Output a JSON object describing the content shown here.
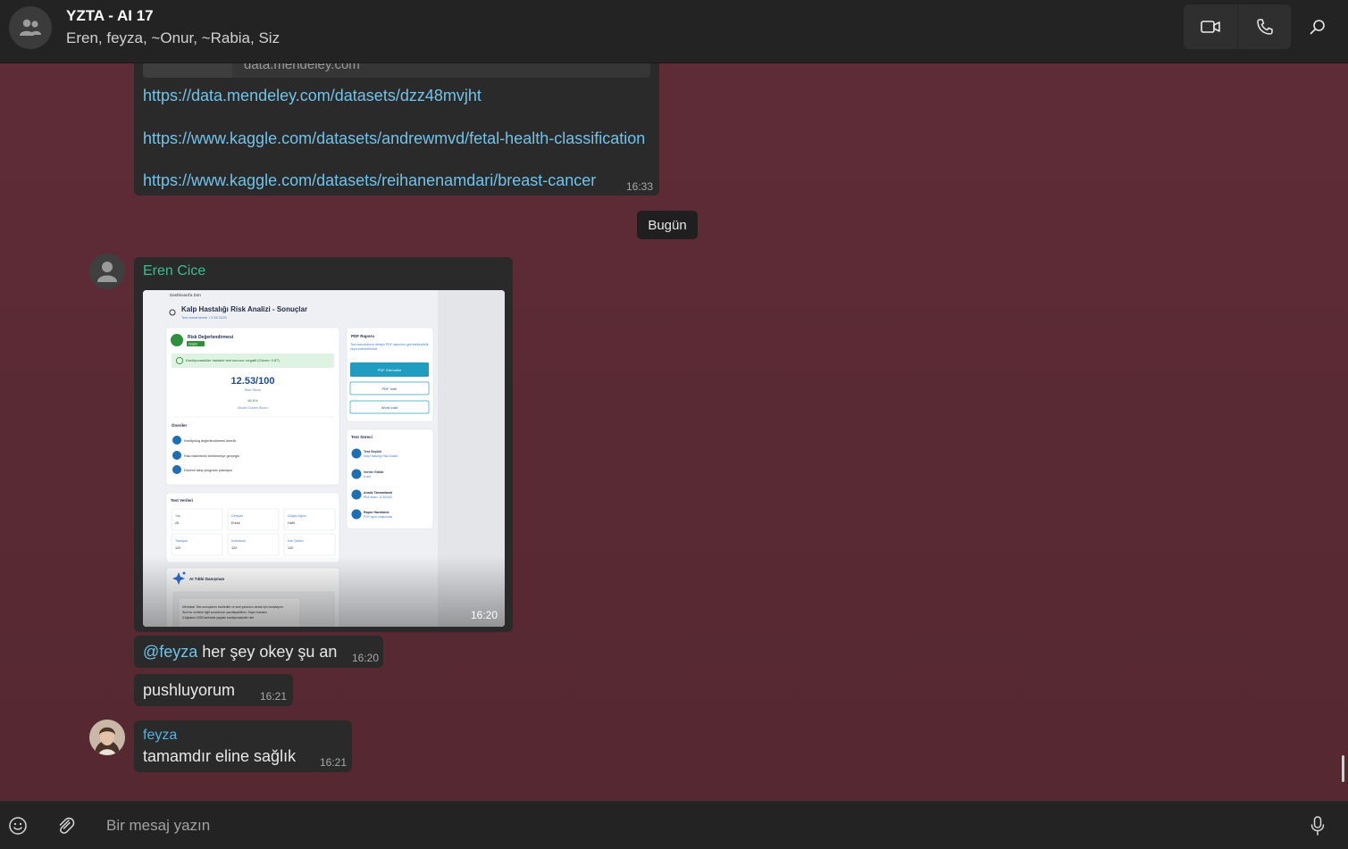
{
  "header": {
    "title": "YZTA - AI 17",
    "participants": "Eren, feyza, ~Onur, ~Rabia, Siz",
    "icons": [
      "group-avatar-icon",
      "video-call-icon",
      "voice-call-icon",
      "search-icon"
    ]
  },
  "messages": {
    "links": {
      "preview_domain": "data.mendeley.com",
      "link1": "https://data.mendeley.com/datasets/dzz48mvjht",
      "link2": "https://www.kaggle.com/datasets/andrewmvd/fetal-health-classification",
      "link3": "https://www.kaggle.com/datasets/reihanenamdari/breast-cancer",
      "time": "16:33"
    },
    "date_separator": "Bugün",
    "image_msg": {
      "sender": "Eren Cice",
      "time": "16:20",
      "screenshot": {
        "back": "Dashboard'a Dön",
        "title": "Kalp Hastalığı Risk Analizi - Sonuçlar",
        "subtitle": "Test tamamlandı • 3.08.2025",
        "risk_title": "Risk Değerlendirmesi",
        "risk_badge": "Düşük",
        "result_text": "Kardiyovasküler hastalık test sonucu: negatif (Güven: 0.87)",
        "score": "12.53/100",
        "score_label": "Risk Skoru",
        "confidence": "86.6%",
        "confidence_label": "Model Güven Skoru",
        "recs_title": "Öneriler",
        "rec1": "Kardiyolog değerlendirmesi önerilir",
        "rec2": "Risk faktörlerini belirlemeye gerçegin",
        "rec3": "Düzenli takip programı planlayın",
        "pdf_title": "PDF Raporu",
        "pdf_desc": "Test sonuçlarının detaylı PDF raporunu görüntüleyebilir veya indirebilirsiniz.",
        "pdf_view": "PDF Görüntüle",
        "pdf_dl": "PDF İndir",
        "word_dl": "Word İndir",
        "process_title": "Test Süreci",
        "step1": "Test Seçildi",
        "step1_sub": "Kalp Hastalığı Risk Analizi",
        "step2": "Veriler Girildi",
        "step2_sub": "6 veri",
        "step3": "Analiz Tamamlandı",
        "step3_sub": "Risk skoru: 12.53/100",
        "step4": "Rapor Hazırlandı",
        "step4_sub": "PDF rapor oluşturuldu",
        "data_title": "Test Verileri",
        "f1_label": "Yaş",
        "f1_val": "25",
        "f2_label": "Cinsiyet",
        "f2_val": "Erkek",
        "f3_label": "Göğüs Ağrısı",
        "f3_val": "Hafif",
        "f4_label": "Tansiyon",
        "f4_val": "120",
        "f5_label": "Kolesterol",
        "f5_val": "120",
        "f6_label": "Kan Şekeri",
        "f6_val": "120",
        "ai_title": "AI Tıbbi Danışman",
        "ai_text1": "Merhaba! Test sonuçlarını inceledim ve size yardımcı olmak için buradayım.",
        "ai_text2": "Size bu verilerle ilgili sorularınızı yanıtlayabilirim. Sayın hastam,",
        "ai_text3": "3 Ağustos 2025 tarihinde yapılan kardiyovasküler risk"
      }
    },
    "msg1": {
      "mention": "@feyza",
      "text": " her şey okey şu an",
      "time": "16:20"
    },
    "msg2": {
      "text": "pushluyorum",
      "time": "16:21"
    },
    "feyza_msg": {
      "sender": "feyza",
      "text": "tamamdır eline sağlık",
      "time": "16:21"
    }
  },
  "composer": {
    "placeholder": "Bir mesaj yazın",
    "icons": [
      "emoji-icon",
      "attach-icon",
      "microphone-icon"
    ]
  },
  "colors": {
    "chat_bg": "#5a2a34",
    "bubble": "#2a2a2a",
    "link": "#71c3ea",
    "name_eren": "#3dbd8f",
    "name_feyza": "#56b2e0"
  }
}
